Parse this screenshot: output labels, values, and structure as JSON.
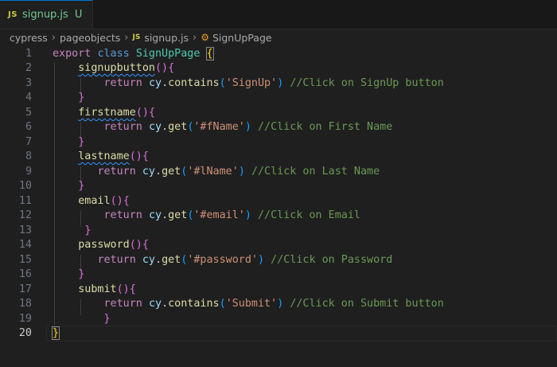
{
  "tab": {
    "js_badge": "JS",
    "filename": "signup.js",
    "status": "U"
  },
  "breadcrumb": {
    "items": [
      "cypress",
      "pageobjects",
      "signup.js",
      "SignUpPage"
    ],
    "js_badge": "JS"
  },
  "editor": {
    "line_numbers": [
      "1",
      "2",
      "3",
      "4",
      "5",
      "6",
      "7",
      "8",
      "9",
      "10",
      "11",
      "12",
      "13",
      "14",
      "15",
      "16",
      "17",
      "18",
      "19",
      "20"
    ],
    "code": {
      "l1": {
        "export": "export",
        "class": "class",
        "name": "SignUpPage",
        "brace": "{"
      },
      "l2": {
        "fn": "signupbutton",
        "paren": "()",
        "brace": "{"
      },
      "l3": {
        "ret": "return",
        "obj": "cy",
        "dot": ".",
        "method": "contains",
        "arg": "'SignUp'",
        "comment": "//Click on SignUp button"
      },
      "l4": {
        "brace": "}"
      },
      "l5": {
        "fn": "firstname",
        "paren": "()",
        "brace": "{"
      },
      "l6": {
        "ret": "return",
        "obj": "cy",
        "dot": ".",
        "method": "get",
        "arg": "'#fName'",
        "comment": "//Click on First Name"
      },
      "l7": {
        "brace": "}"
      },
      "l8": {
        "fn": "lastname",
        "paren": "()",
        "brace": "{"
      },
      "l9": {
        "ret": "return",
        "obj": "cy",
        "dot": ".",
        "method": "get",
        "arg": "'#lName'",
        "comment": "//Click on Last Name"
      },
      "l10": {
        "brace": "}"
      },
      "l11": {
        "fn": "email",
        "paren": "()",
        "brace": "{"
      },
      "l12": {
        "ret": "return",
        "obj": "cy",
        "dot": ".",
        "method": "get",
        "arg": "'#email'",
        "comment": "//Click on Email"
      },
      "l13": {
        "brace": "}"
      },
      "l14": {
        "fn": "password",
        "paren": "()",
        "brace": "{"
      },
      "l15": {
        "ret": "return",
        "obj": "cy",
        "dot": ".",
        "method": "get",
        "arg": "'#password'",
        "comment": "//Click on Password"
      },
      "l16": {
        "brace": "}"
      },
      "l17": {
        "fn": "submit",
        "paren": "()",
        "brace": "{"
      },
      "l18": {
        "ret": "return",
        "obj": "cy",
        "dot": ".",
        "method": "contains",
        "arg": "'Submit'",
        "comment": "//Click on Submit button"
      },
      "l19": {
        "brace": "}"
      },
      "l20": {
        "brace": "}"
      }
    }
  },
  "colors": {
    "background": "#1f1f1f",
    "keyword": "#c586c0",
    "class_name": "#4ec9b0",
    "function": "#dcdcaa",
    "string": "#ce9178",
    "comment": "#6a9955"
  }
}
